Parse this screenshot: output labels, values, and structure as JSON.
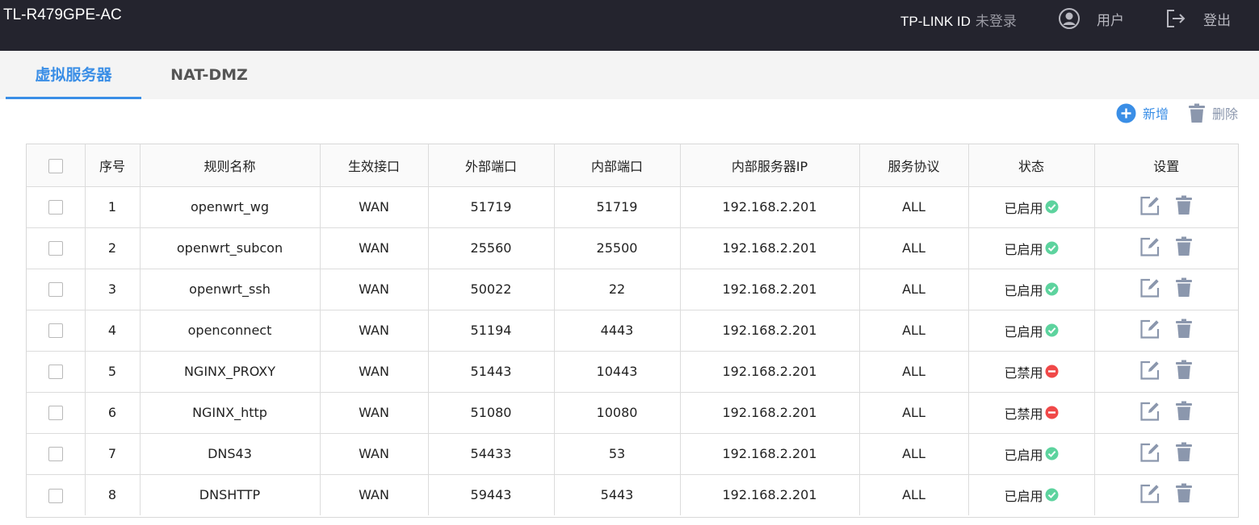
{
  "header": {
    "device_name": "TL-R479GPE-AC",
    "tplink_id_label": "TP-LINK ID",
    "login_status": "未登录",
    "user_label": "用户",
    "logout_label": "登出"
  },
  "tabs": [
    {
      "label": "虚拟服务器",
      "active": true
    },
    {
      "label": "NAT-DMZ",
      "active": false
    }
  ],
  "toolbar": {
    "add_label": "新增",
    "delete_label": "删除"
  },
  "colors": {
    "accent": "#3a8ee6",
    "enabled": "#5dd39e",
    "disabled": "#f04848",
    "header_bg": "#24242e"
  },
  "table": {
    "columns": [
      "序号",
      "规则名称",
      "生效接口",
      "外部端口",
      "内部端口",
      "内部服务器IP",
      "服务协议",
      "状态",
      "设置"
    ],
    "rows": [
      {
        "index": "1",
        "name": "openwrt_wg",
        "interface": "WAN",
        "ext_port": "51719",
        "int_port": "51719",
        "ip": "192.168.2.201",
        "protocol": "ALL",
        "status": "已启用",
        "enabled": true
      },
      {
        "index": "2",
        "name": "openwrt_subcon",
        "interface": "WAN",
        "ext_port": "25560",
        "int_port": "25500",
        "ip": "192.168.2.201",
        "protocol": "ALL",
        "status": "已启用",
        "enabled": true
      },
      {
        "index": "3",
        "name": "openwrt_ssh",
        "interface": "WAN",
        "ext_port": "50022",
        "int_port": "22",
        "ip": "192.168.2.201",
        "protocol": "ALL",
        "status": "已启用",
        "enabled": true
      },
      {
        "index": "4",
        "name": "openconnect",
        "interface": "WAN",
        "ext_port": "51194",
        "int_port": "4443",
        "ip": "192.168.2.201",
        "protocol": "ALL",
        "status": "已启用",
        "enabled": true
      },
      {
        "index": "5",
        "name": "NGINX_PROXY",
        "interface": "WAN",
        "ext_port": "51443",
        "int_port": "10443",
        "ip": "192.168.2.201",
        "protocol": "ALL",
        "status": "已禁用",
        "enabled": false
      },
      {
        "index": "6",
        "name": "NGINX_http",
        "interface": "WAN",
        "ext_port": "51080",
        "int_port": "10080",
        "ip": "192.168.2.201",
        "protocol": "ALL",
        "status": "已禁用",
        "enabled": false
      },
      {
        "index": "7",
        "name": "DNS43",
        "interface": "WAN",
        "ext_port": "54433",
        "int_port": "53",
        "ip": "192.168.2.201",
        "protocol": "ALL",
        "status": "已启用",
        "enabled": true
      },
      {
        "index": "8",
        "name": "DNSHTTP",
        "interface": "WAN",
        "ext_port": "59443",
        "int_port": "5443",
        "ip": "192.168.2.201",
        "protocol": "ALL",
        "status": "已启用",
        "enabled": true
      }
    ]
  }
}
